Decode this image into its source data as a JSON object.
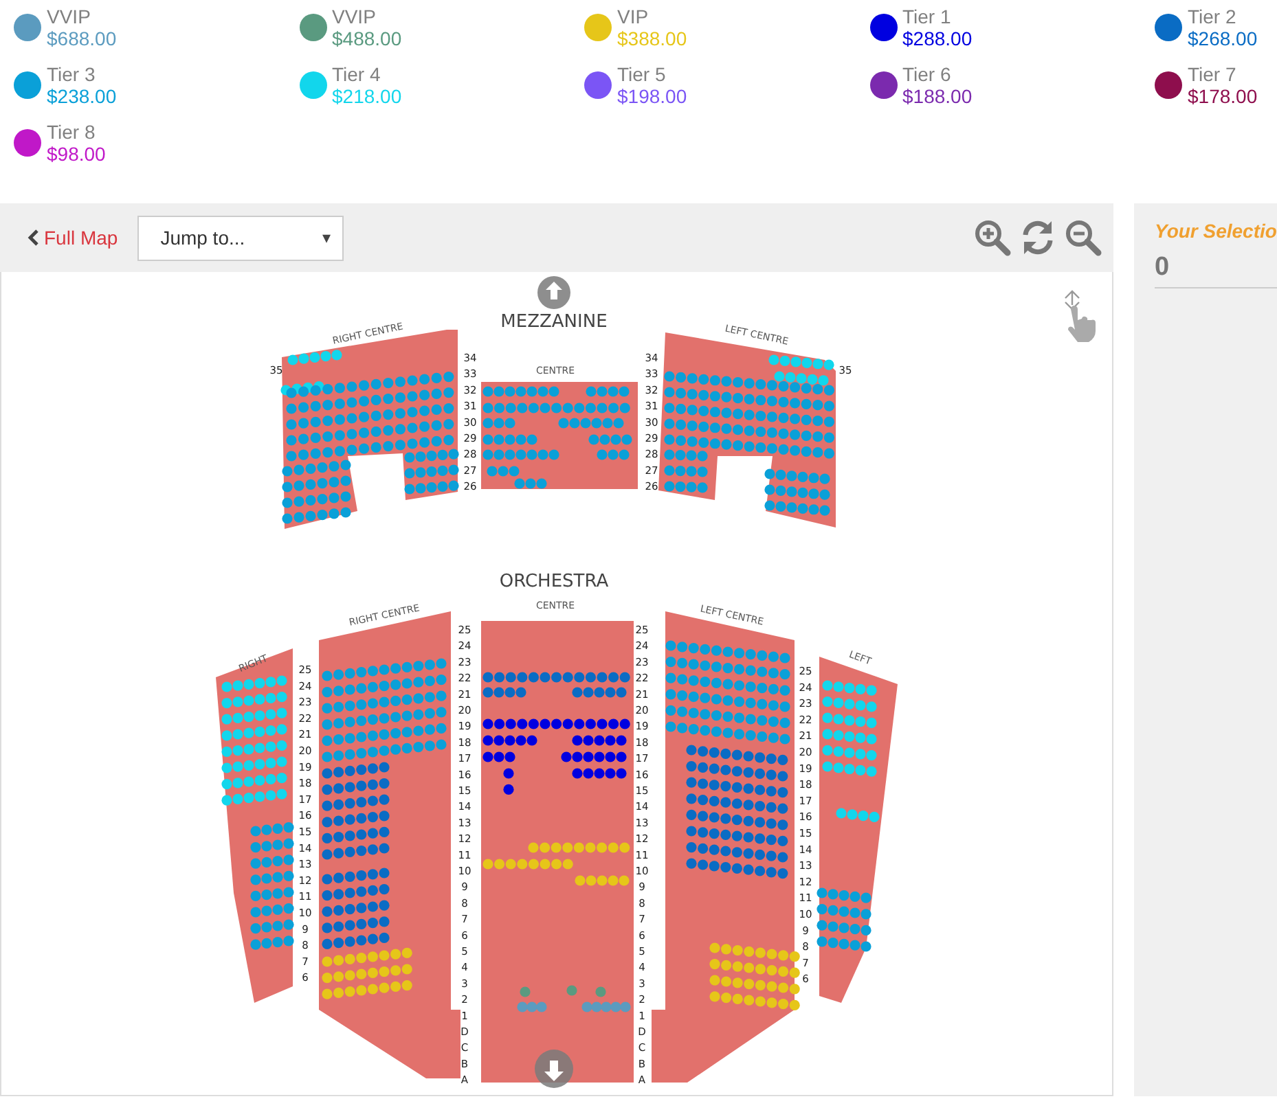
{
  "legend": [
    {
      "name": "VVIP",
      "price": "$688.00",
      "color": "#5b9bbf"
    },
    {
      "name": "VVIP",
      "price": "$488.00",
      "color": "#5a9a80"
    },
    {
      "name": "VIP",
      "price": "$388.00",
      "color": "#e6c619"
    },
    {
      "name": "Tier 1",
      "price": "$288.00",
      "color": "#0000e0"
    },
    {
      "name": "Tier 2",
      "price": "$268.00",
      "color": "#0a6cc4"
    },
    {
      "name": "Tier 3",
      "price": "$238.00",
      "color": "#0aa0d8"
    },
    {
      "name": "Tier 4",
      "price": "$218.00",
      "color": "#12d6ec"
    },
    {
      "name": "Tier 5",
      "price": "$198.00",
      "color": "#7b55f5"
    },
    {
      "name": "Tier 6",
      "price": "$188.00",
      "color": "#7b2aae"
    },
    {
      "name": "Tier 7",
      "price": "$178.00",
      "color": "#8e0e4d"
    },
    {
      "name": "Tier 8",
      "price": "$98.00",
      "color": "#c018c8"
    }
  ],
  "toolbar": {
    "back_link": "Full Map",
    "jump": {
      "value": "Jump to...",
      "caret": "▾"
    }
  },
  "selection": {
    "title": "Your Selectio",
    "count": "0"
  },
  "map": {
    "levels": [
      {
        "kind": "mezzanine",
        "title": "MEZZANINE",
        "sections": [
          {
            "kind": "right_centre",
            "label": "RIGHT CENTRE"
          },
          {
            "kind": "centre",
            "label": "CENTRE"
          },
          {
            "kind": "left_centre",
            "label": "LEFT CENTRE"
          }
        ]
      },
      {
        "kind": "orchestra",
        "title": "ORCHESTRA",
        "sections": [
          {
            "kind": "right",
            "label": "RIGHT"
          },
          {
            "kind": "right_centre",
            "label": "RIGHT CENTRE"
          },
          {
            "kind": "centre",
            "label": "CENTRE"
          },
          {
            "kind": "left_centre",
            "label": "LEFT CENTRE"
          },
          {
            "kind": "left",
            "label": "LEFT"
          }
        ]
      }
    ],
    "row_label_columns": [
      {
        "kind": "mezz_right_outer",
        "labels": [
          "35"
        ]
      },
      {
        "kind": "mezz_centre_left",
        "labels": [
          "34",
          "33",
          "32",
          "31",
          "30",
          "29",
          "28",
          "27",
          "26"
        ]
      },
      {
        "kind": "mezz_centre_right",
        "labels": [
          "34",
          "33",
          "32",
          "31",
          "30",
          "29",
          "28",
          "27",
          "26"
        ]
      },
      {
        "kind": "mezz_left_outer",
        "labels": [
          "35"
        ]
      },
      {
        "kind": "orch_right",
        "labels": [
          "25",
          "24",
          "23",
          "22",
          "21",
          "20",
          "19",
          "18",
          "17",
          "16",
          "15",
          "14",
          "13",
          "12",
          "11",
          "10",
          "9",
          "8",
          "7",
          "6"
        ]
      },
      {
        "kind": "orch_centre_left",
        "labels": [
          "25",
          "24",
          "23",
          "22",
          "21",
          "20",
          "19",
          "18",
          "17",
          "16",
          "15",
          "14",
          "13",
          "12",
          "11",
          "10",
          "9",
          "8",
          "7",
          "6",
          "5",
          "4",
          "3",
          "2",
          "1",
          "D",
          "C",
          "B",
          "A"
        ]
      },
      {
        "kind": "orch_centre_right",
        "labels": [
          "25",
          "24",
          "23",
          "22",
          "21",
          "20",
          "19",
          "18",
          "17",
          "16",
          "15",
          "14",
          "13",
          "12",
          "11",
          "10",
          "9",
          "8",
          "7",
          "6",
          "5",
          "4",
          "3",
          "2",
          "1",
          "D",
          "C",
          "B",
          "A"
        ]
      },
      {
        "kind": "orch_left",
        "labels": [
          "25",
          "24",
          "23",
          "22",
          "21",
          "20",
          "19",
          "18",
          "17",
          "16",
          "15",
          "14",
          "13",
          "12",
          "11",
          "10",
          "9",
          "8",
          "7",
          "6"
        ]
      }
    ]
  }
}
